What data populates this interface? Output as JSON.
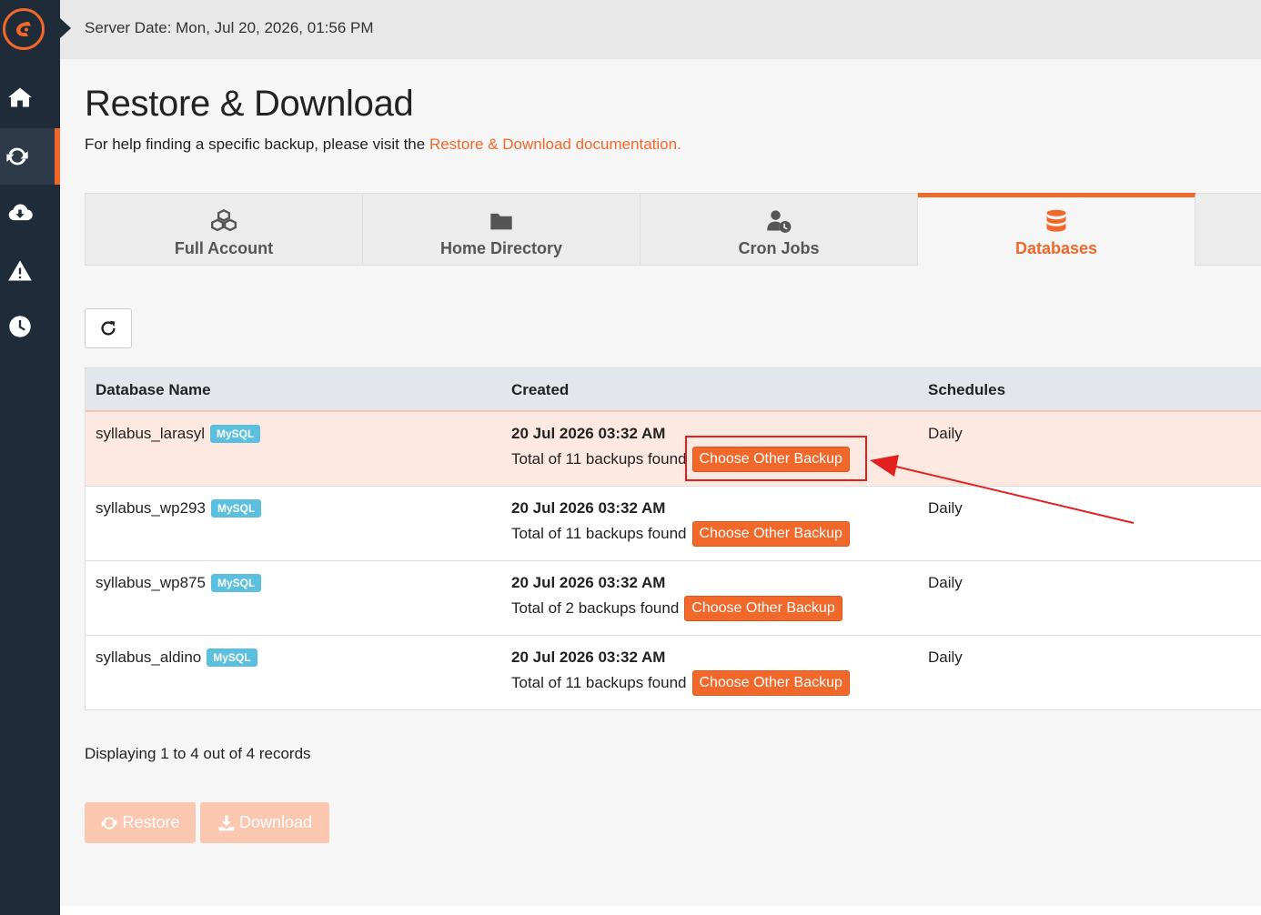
{
  "sidebar": {
    "logo_icon": "cpanel-logo-icon",
    "items": [
      {
        "name": "home-icon"
      },
      {
        "name": "sync-icon",
        "active": true
      },
      {
        "name": "cloud-download-icon"
      },
      {
        "name": "warning-icon"
      },
      {
        "name": "clock-icon"
      }
    ]
  },
  "topbar": {
    "server_date": "Server Date: Mon, Jul 20, 2026, 01:56 PM"
  },
  "page": {
    "title": "Restore & Download",
    "help_prefix": "For help finding a specific backup, please visit the ",
    "help_link": "Restore & Download documentation."
  },
  "tabs": [
    {
      "label": "Full Account",
      "icon": "cubes-icon"
    },
    {
      "label": "Home Directory",
      "icon": "folder-icon"
    },
    {
      "label": "Cron Jobs",
      "icon": "user-clock-icon"
    },
    {
      "label": "Databases",
      "icon": "database-icon",
      "active": true
    }
  ],
  "table": {
    "headers": {
      "name": "Database Name",
      "created": "Created",
      "schedules": "Schedules"
    },
    "rows": [
      {
        "name": "syllabus_larasyl",
        "engine": "MySQL",
        "date": "20 Jul 2026 03:32 AM",
        "total": "Total of 11 backups found",
        "button": "Choose Other Backup",
        "schedule": "Daily",
        "selected": true
      },
      {
        "name": "syllabus_wp293",
        "engine": "MySQL",
        "date": "20 Jul 2026 03:32 AM",
        "total": "Total of 11 backups found",
        "button": "Choose Other Backup",
        "schedule": "Daily"
      },
      {
        "name": "syllabus_wp875",
        "engine": "MySQL",
        "date": "20 Jul 2026 03:32 AM",
        "total": "Total of 2 backups found",
        "button": "Choose Other Backup",
        "schedule": "Daily"
      },
      {
        "name": "syllabus_aldino",
        "engine": "MySQL",
        "date": "20 Jul 2026 03:32 AM",
        "total": "Total of 11 backups found",
        "button": "Choose Other Backup",
        "schedule": "Daily"
      }
    ]
  },
  "footer": {
    "records": "Displaying 1 to 4 out of 4 records",
    "restore_label": "Restore",
    "download_label": "Download"
  },
  "colors": {
    "accent": "#f2672a",
    "sidebar": "#1f2b38",
    "badge": "#5bc0de",
    "annotation": "#e32020"
  }
}
